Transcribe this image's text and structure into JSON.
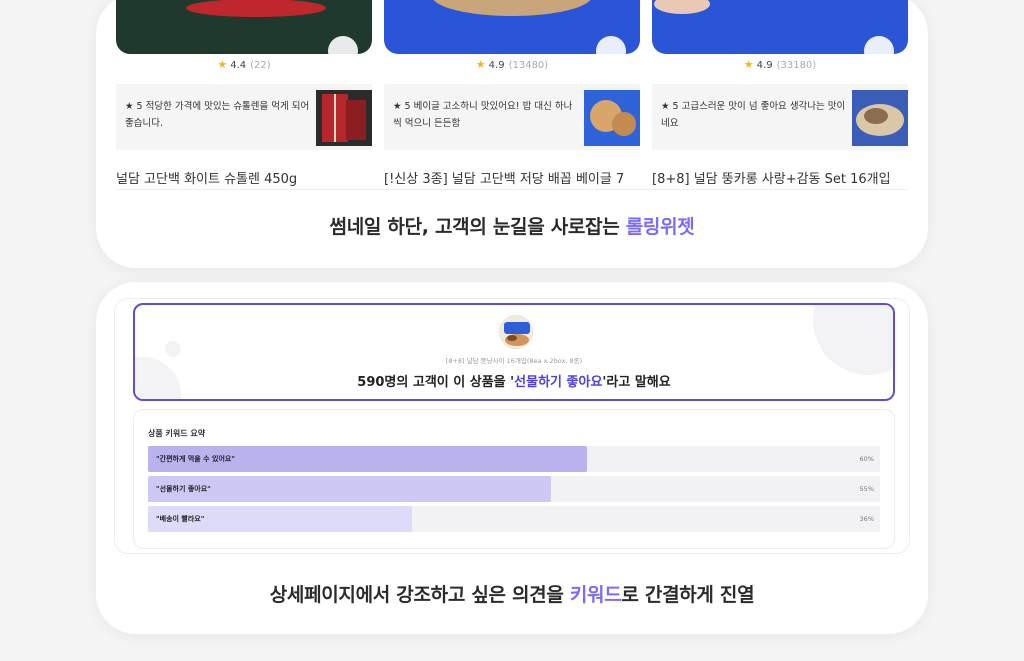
{
  "top_card": {
    "products": [
      {
        "rating": "4.4",
        "review_count": "(22)",
        "review_text": "★ 5 적당한 가격에 맛있는 슈톨렌을 먹게 되어 좋습니다.",
        "name": "널담 고단백 화이트 슈톨렌 450g",
        "thumb_color": "#1f3a2c",
        "thumb_accent": "#c0282d"
      },
      {
        "rating": "4.9",
        "review_count": "(13480)",
        "review_text": "★ 5 베이글 고소하니 맛있어요! 밥 대신 하나씩 먹으니 든든함",
        "name": "[!신상 3종] 널담 고단백 저당 배꼽 베이글 7",
        "thumb_color": "#2b55d8",
        "thumb_accent": "#c9a679"
      },
      {
        "rating": "4.9",
        "review_count": "(33180)",
        "review_text": "★ 5 고급스러운 맛이 넘 좋아요 생각나는 맛이네요",
        "name": "[8+8] 널담 뚱카롱 사랑+감동 Set 16개입",
        "thumb_color": "#2a55d6",
        "thumb_accent": "#e9c8b4"
      }
    ],
    "caption_main": "썸네일 하단, 고객의 눈길을 사로잡는 ",
    "caption_accent": "롤링위젯"
  },
  "bottom_card": {
    "product_name": "[8+8] 널담 뚱냥사이 16개입(8ea x 2box, 8종)",
    "headline_prefix": "590명의 고객이 이 상품을 '",
    "headline_keyword": "선물하기 좋아요",
    "headline_suffix": "'라고 말해요",
    "summary_title": "상품 키워드 요약",
    "keywords": [
      {
        "label": "\"간편하게 먹을 수 있어요\"",
        "percent_text": "60%",
        "value": 60,
        "color": "#b9b2ef"
      },
      {
        "label": "\"선물하기 좋아요\"",
        "percent_text": "55%",
        "value": 55,
        "color": "#cdc8f4"
      },
      {
        "label": "\"배송이 빨라요\"",
        "percent_text": "36%",
        "value": 36,
        "color": "#dedbf8"
      }
    ],
    "caption_pre": "상세페이지에서 강조하고 싶은 의견을 ",
    "caption_accent": "키워드",
    "caption_post": "로 간결하게 진열"
  },
  "colors": {
    "accent_purple": "#7b6cf6",
    "border_purple": "#5b4fd6",
    "keyword_blue": "#4d3fe0",
    "star": "#f2b51f"
  }
}
